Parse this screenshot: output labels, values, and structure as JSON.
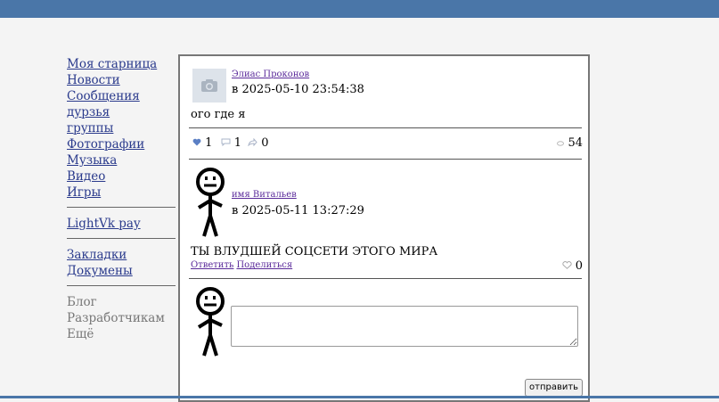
{
  "sidebar": {
    "group1": [
      "Моя старница",
      "Новости",
      "Сообщения",
      "дурзья",
      "группы",
      "Фотографии",
      "Музыка",
      "Видео",
      "Игры"
    ],
    "group2": [
      "LightVk pay"
    ],
    "group3": [
      "Закладки",
      "Докумены"
    ],
    "group4": [
      "Блог",
      "Разработчикам",
      "Ещё"
    ]
  },
  "post": {
    "author": "Элиас Проконов",
    "date": "в 2025-05-10 23:54:38",
    "text": "ого где я",
    "likes": "1",
    "comments": "1",
    "shares": "0",
    "views": "54"
  },
  "comment": {
    "author": "имя Витальев",
    "date": "в 2025-05-11 13:27:29",
    "text": "ТЫ ВЛУДШЕЙ СОЦСЕТИ ЭТОГО МИРА",
    "reply_label": "Ответить",
    "share_label": "Поделиться",
    "likes": "0"
  },
  "reply": {
    "value": "",
    "send_label": "отправить"
  },
  "colors": {
    "brand": "#4a76a8",
    "link": "#2a3a8c",
    "author_link": "#5a2a9a"
  }
}
